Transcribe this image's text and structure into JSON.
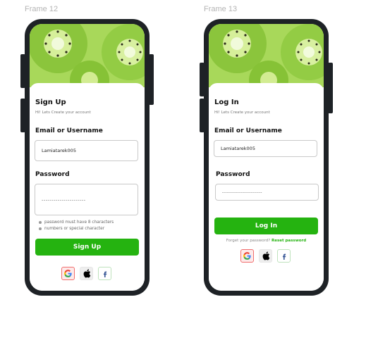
{
  "frames": [
    {
      "label": "Frame 12",
      "title": "Sign Up",
      "subtitle": "Hi! Lets Create your account",
      "email_label": "Email or Username",
      "email_value": "Lamiatarek005",
      "password_label": "Password",
      "password_value": "----------------------",
      "hints": [
        "password must have 8 characters",
        "numbers or special character"
      ],
      "button_label": "Sign Up"
    },
    {
      "label": "Frame 13",
      "title": "Log In",
      "subtitle": "Hi! Lets Create your account",
      "email_label": "Email or Username",
      "email_value": "Lamiatarek005",
      "password_label": "Password",
      "password_value": "--------------------",
      "button_label": "Log In",
      "forgot_text": "Forget your password?",
      "reset_link": "Reset password"
    }
  ],
  "socials": [
    {
      "icon": "google-icon",
      "glyph": "G"
    },
    {
      "icon": "apple-icon",
      "glyph": ""
    },
    {
      "icon": "facebook-icon",
      "glyph": "f"
    }
  ],
  "colors": {
    "accent_green": "#25b310",
    "phone_frame": "#1e2226",
    "kiwi_flesh": "#9bd24a"
  }
}
